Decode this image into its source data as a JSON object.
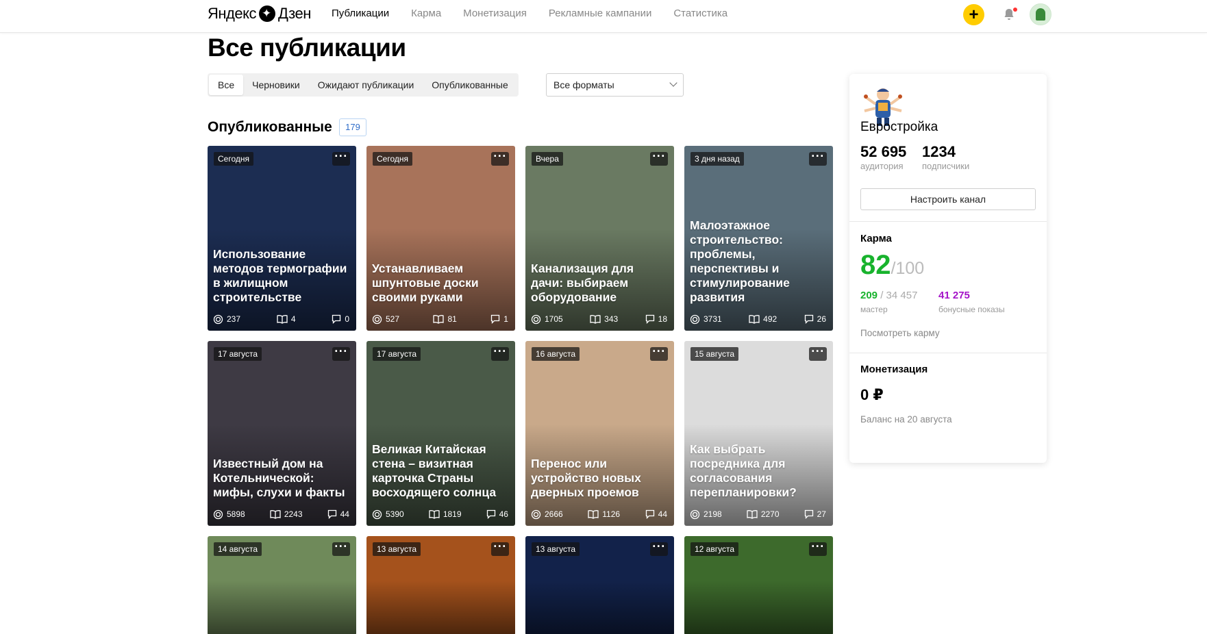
{
  "header": {
    "logo_brand": "Яндекс",
    "logo_product": "Дзен",
    "nav": [
      {
        "label": "Публикации",
        "active": true
      },
      {
        "label": "Карма",
        "active": false
      },
      {
        "label": "Монетизация",
        "active": false
      },
      {
        "label": "Рекламные кампании",
        "active": false
      },
      {
        "label": "Статистика",
        "active": false
      }
    ],
    "add_button": "+"
  },
  "page_title": "Все публикации",
  "filters": {
    "tabs": [
      {
        "label": "Все",
        "active": true
      },
      {
        "label": "Черновики",
        "active": false
      },
      {
        "label": "Ожидают публикации",
        "active": false
      },
      {
        "label": "Опубликованные",
        "active": false
      }
    ],
    "format_select": "Все форматы"
  },
  "section": {
    "title": "Опубликованные",
    "count": "179"
  },
  "cards": [
    {
      "date": "Сегодня",
      "title": "Использование методов термографии в жилищном строительстве",
      "views": "237",
      "reads": "4",
      "comments": "0",
      "bg": "#1c2d52"
    },
    {
      "date": "Сегодня",
      "title": "Устанавливаем шпунтовые доски своими руками",
      "views": "527",
      "reads": "81",
      "comments": "1",
      "bg": "#a8735a"
    },
    {
      "date": "Вчера",
      "title": "Канализация для дачи: выбираем оборудование",
      "views": "1705",
      "reads": "343",
      "comments": "18",
      "bg": "#6a7a62"
    },
    {
      "date": "3 дня назад",
      "title": "Малоэтажное строительство: проблемы, перспективы и стимулирование развития",
      "views": "3731",
      "reads": "492",
      "comments": "26",
      "bg": "#5a6e7a"
    },
    {
      "date": "17 августа",
      "title": "Известный дом на Котельнической: мифы, слухи и факты",
      "views": "5898",
      "reads": "2243",
      "comments": "44",
      "bg": "#3e3a44"
    },
    {
      "date": "17 августа",
      "title": "Великая Китайская стена – визитная карточка Страны восходящего солнца",
      "views": "5390",
      "reads": "1819",
      "comments": "46",
      "bg": "#4a5a48"
    },
    {
      "date": "16 августа",
      "title": "Перенос или устройство новых дверных проемов",
      "views": "2666",
      "reads": "1126",
      "comments": "44",
      "bg": "#c9a98a"
    },
    {
      "date": "15 августа",
      "title": "Как выбрать посредника для согласования перепланировки?",
      "views": "2198",
      "reads": "2270",
      "comments": "27",
      "bg": "#dcdcdc"
    },
    {
      "date": "14 августа",
      "title": "",
      "views": "",
      "reads": "",
      "comments": "",
      "bg": "#6f8a5a"
    },
    {
      "date": "13 августа",
      "title": "",
      "views": "",
      "reads": "",
      "comments": "",
      "bg": "#a5521c"
    },
    {
      "date": "13 августа",
      "title": "",
      "views": "",
      "reads": "",
      "comments": "",
      "bg": "#12224a"
    },
    {
      "date": "12 августа",
      "title": "",
      "views": "",
      "reads": "",
      "comments": "",
      "bg": "#3d6a2c"
    }
  ],
  "sidebar": {
    "channel_name": "Евростройка",
    "audience_value": "52 695",
    "audience_label": "аудитория",
    "subscribers_value": "1234",
    "subscribers_label": "подписчики",
    "configure_button": "Настроить канал",
    "karma_title": "Карма",
    "karma_score": "82",
    "karma_max": "/100",
    "rank_value": "209",
    "rank_total": " / 34 457",
    "rank_label": "мастер",
    "bonus_value": "41 275",
    "bonus_label": "бонусные показы",
    "karma_link": "Посмотреть карму",
    "monetization_title": "Монетизация",
    "monetization_amount": "0 ₽",
    "balance_label": "Баланс на 20 августа"
  }
}
